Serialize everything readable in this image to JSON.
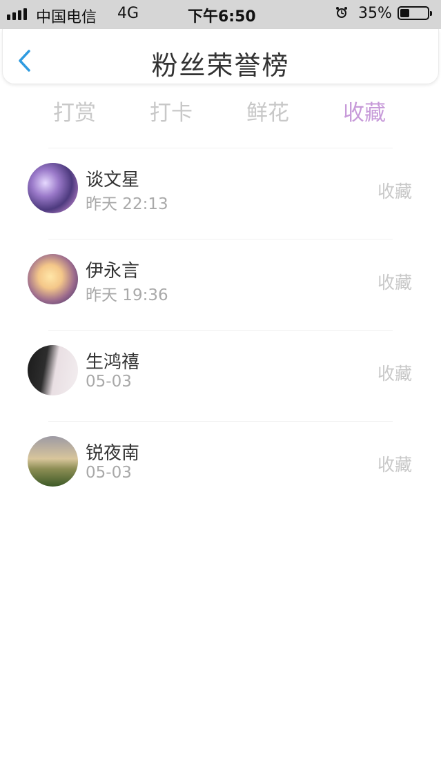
{
  "status_bar": {
    "carrier": "中国电信",
    "network": "4G",
    "time": "下午6:50",
    "battery": "35%",
    "battery_level": 0.35,
    "icons": [
      "signal-icon",
      "alarm-icon",
      "battery-icon"
    ]
  },
  "header": {
    "title": "粉丝荣誉榜",
    "back_icon": "chevron-left-icon",
    "accent_color": "#2f9be0"
  },
  "tabs": [
    {
      "label": "打赏",
      "active": false
    },
    {
      "label": "打卡",
      "active": false
    },
    {
      "label": "鲜花",
      "active": false
    },
    {
      "label": "收藏",
      "active": true
    }
  ],
  "colors": {
    "active_tab": "#c79ad9",
    "inactive_tab": "#c8c8c8",
    "status_bar_bg": "#d6d6d6"
  },
  "fans": [
    {
      "name": "谈文星",
      "time": "昨天 22:13",
      "action": "收藏"
    },
    {
      "name": "伊永言",
      "time": "昨天 19:36",
      "action": "收藏"
    },
    {
      "name": "生鸿禧",
      "time": "05-03",
      "action": "收藏"
    },
    {
      "name": "锐夜南",
      "time": "05-03",
      "action": "收藏"
    }
  ]
}
